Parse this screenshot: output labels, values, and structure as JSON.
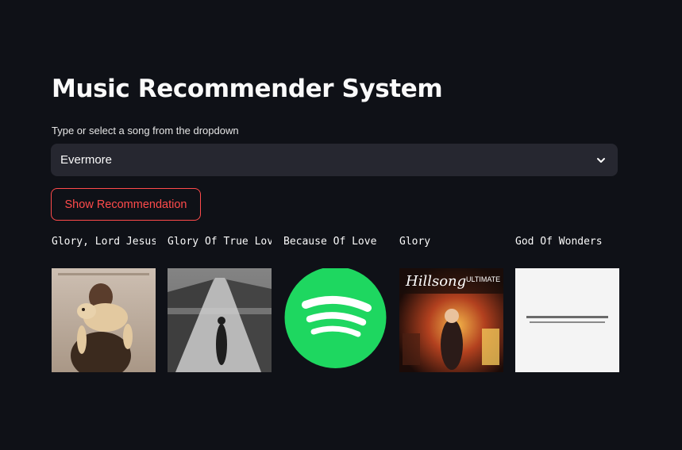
{
  "app": {
    "title": "Music Recommender System"
  },
  "song_select": {
    "label": "Type or select a song from the dropdown",
    "selected_value": "Evermore",
    "icon": "chevron-down-icon"
  },
  "recommend_button": {
    "label": "Show Recommendation",
    "color": "#ff4b4b"
  },
  "recommendations": [
    {
      "title": "Glory, Lord Jesus"
    },
    {
      "title": "Glory Of True Love"
    },
    {
      "title": "Because Of Love"
    },
    {
      "title": "Glory"
    },
    {
      "title": "God Of Wonders"
    }
  ],
  "theme": {
    "background": "#0f1117",
    "input_background": "#262730",
    "spotify_green": "#1ed760"
  }
}
